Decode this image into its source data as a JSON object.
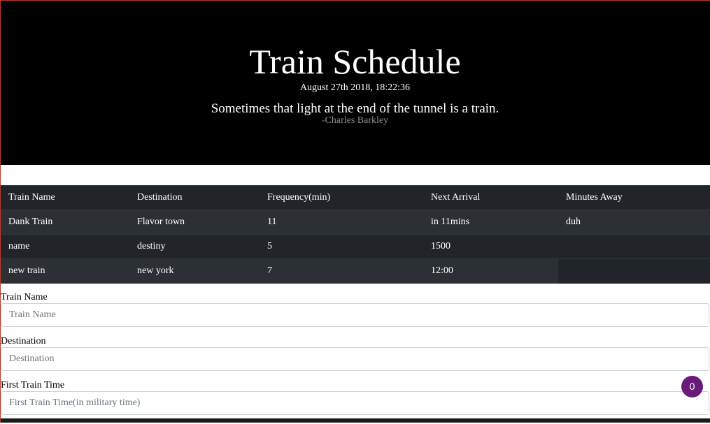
{
  "header": {
    "title": "Train Schedule",
    "datetime": "August 27th 2018, 18:22:36",
    "quote": "Sometimes that light at the end of the tunnel is a train.",
    "author": "-Charles Barkley"
  },
  "table": {
    "columns": [
      "Train Name",
      "Destination",
      "Frequency(min)",
      "Next Arrival",
      "Minutes Away"
    ],
    "rows": [
      [
        "Dank Train",
        "Flavor town",
        "11",
        "in 11mins",
        "duh"
      ],
      [
        "name",
        "destiny",
        "5",
        "1500",
        ""
      ],
      [
        "new train",
        "new york",
        "7",
        "12:00",
        ""
      ]
    ]
  },
  "form": {
    "train_name": {
      "label": "Train Name",
      "placeholder": "Train Name",
      "value": ""
    },
    "destination": {
      "label": "Destination",
      "placeholder": "Destination",
      "value": ""
    },
    "first_train_time": {
      "label": "First Train Time",
      "placeholder": "First Train Time(in military time)",
      "value": ""
    }
  },
  "badge": {
    "count": "0"
  },
  "colors": {
    "header_bg": "#000000",
    "table_dark": "#212529",
    "table_stripe": "#2c3034",
    "badge": "#6a1b7a"
  }
}
